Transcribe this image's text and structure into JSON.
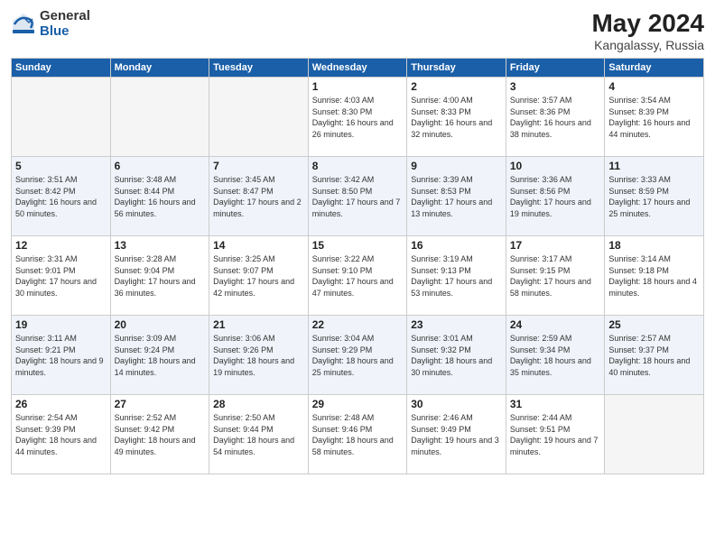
{
  "logo": {
    "general": "General",
    "blue": "Blue"
  },
  "header": {
    "month_year": "May 2024",
    "location": "Kangalassy, Russia"
  },
  "weekdays": [
    "Sunday",
    "Monday",
    "Tuesday",
    "Wednesday",
    "Thursday",
    "Friday",
    "Saturday"
  ],
  "weeks": [
    [
      {
        "day": "",
        "empty": true
      },
      {
        "day": "",
        "empty": true
      },
      {
        "day": "",
        "empty": true
      },
      {
        "day": "1",
        "sunrise": "4:03 AM",
        "sunset": "8:30 PM",
        "daylight": "16 hours and 26 minutes."
      },
      {
        "day": "2",
        "sunrise": "4:00 AM",
        "sunset": "8:33 PM",
        "daylight": "16 hours and 32 minutes."
      },
      {
        "day": "3",
        "sunrise": "3:57 AM",
        "sunset": "8:36 PM",
        "daylight": "16 hours and 38 minutes."
      },
      {
        "day": "4",
        "sunrise": "3:54 AM",
        "sunset": "8:39 PM",
        "daylight": "16 hours and 44 minutes."
      }
    ],
    [
      {
        "day": "5",
        "sunrise": "3:51 AM",
        "sunset": "8:42 PM",
        "daylight": "16 hours and 50 minutes."
      },
      {
        "day": "6",
        "sunrise": "3:48 AM",
        "sunset": "8:44 PM",
        "daylight": "16 hours and 56 minutes."
      },
      {
        "day": "7",
        "sunrise": "3:45 AM",
        "sunset": "8:47 PM",
        "daylight": "17 hours and 2 minutes."
      },
      {
        "day": "8",
        "sunrise": "3:42 AM",
        "sunset": "8:50 PM",
        "daylight": "17 hours and 7 minutes."
      },
      {
        "day": "9",
        "sunrise": "3:39 AM",
        "sunset": "8:53 PM",
        "daylight": "17 hours and 13 minutes."
      },
      {
        "day": "10",
        "sunrise": "3:36 AM",
        "sunset": "8:56 PM",
        "daylight": "17 hours and 19 minutes."
      },
      {
        "day": "11",
        "sunrise": "3:33 AM",
        "sunset": "8:59 PM",
        "daylight": "17 hours and 25 minutes."
      }
    ],
    [
      {
        "day": "12",
        "sunrise": "3:31 AM",
        "sunset": "9:01 PM",
        "daylight": "17 hours and 30 minutes."
      },
      {
        "day": "13",
        "sunrise": "3:28 AM",
        "sunset": "9:04 PM",
        "daylight": "17 hours and 36 minutes."
      },
      {
        "day": "14",
        "sunrise": "3:25 AM",
        "sunset": "9:07 PM",
        "daylight": "17 hours and 42 minutes."
      },
      {
        "day": "15",
        "sunrise": "3:22 AM",
        "sunset": "9:10 PM",
        "daylight": "17 hours and 47 minutes."
      },
      {
        "day": "16",
        "sunrise": "3:19 AM",
        "sunset": "9:13 PM",
        "daylight": "17 hours and 53 minutes."
      },
      {
        "day": "17",
        "sunrise": "3:17 AM",
        "sunset": "9:15 PM",
        "daylight": "17 hours and 58 minutes."
      },
      {
        "day": "18",
        "sunrise": "3:14 AM",
        "sunset": "9:18 PM",
        "daylight": "18 hours and 4 minutes."
      }
    ],
    [
      {
        "day": "19",
        "sunrise": "3:11 AM",
        "sunset": "9:21 PM",
        "daylight": "18 hours and 9 minutes."
      },
      {
        "day": "20",
        "sunrise": "3:09 AM",
        "sunset": "9:24 PM",
        "daylight": "18 hours and 14 minutes."
      },
      {
        "day": "21",
        "sunrise": "3:06 AM",
        "sunset": "9:26 PM",
        "daylight": "18 hours and 19 minutes."
      },
      {
        "day": "22",
        "sunrise": "3:04 AM",
        "sunset": "9:29 PM",
        "daylight": "18 hours and 25 minutes."
      },
      {
        "day": "23",
        "sunrise": "3:01 AM",
        "sunset": "9:32 PM",
        "daylight": "18 hours and 30 minutes."
      },
      {
        "day": "24",
        "sunrise": "2:59 AM",
        "sunset": "9:34 PM",
        "daylight": "18 hours and 35 minutes."
      },
      {
        "day": "25",
        "sunrise": "2:57 AM",
        "sunset": "9:37 PM",
        "daylight": "18 hours and 40 minutes."
      }
    ],
    [
      {
        "day": "26",
        "sunrise": "2:54 AM",
        "sunset": "9:39 PM",
        "daylight": "18 hours and 44 minutes."
      },
      {
        "day": "27",
        "sunrise": "2:52 AM",
        "sunset": "9:42 PM",
        "daylight": "18 hours and 49 minutes."
      },
      {
        "day": "28",
        "sunrise": "2:50 AM",
        "sunset": "9:44 PM",
        "daylight": "18 hours and 54 minutes."
      },
      {
        "day": "29",
        "sunrise": "2:48 AM",
        "sunset": "9:46 PM",
        "daylight": "18 hours and 58 minutes."
      },
      {
        "day": "30",
        "sunrise": "2:46 AM",
        "sunset": "9:49 PM",
        "daylight": "19 hours and 3 minutes."
      },
      {
        "day": "31",
        "sunrise": "2:44 AM",
        "sunset": "9:51 PM",
        "daylight": "19 hours and 7 minutes."
      },
      {
        "day": "",
        "empty": true
      }
    ]
  ],
  "labels": {
    "sunrise": "Sunrise:",
    "sunset": "Sunset:",
    "daylight": "Daylight:"
  }
}
